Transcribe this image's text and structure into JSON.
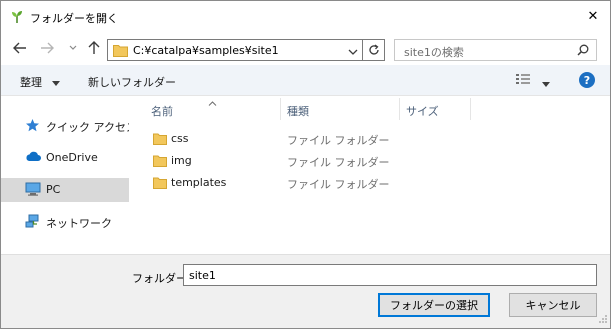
{
  "window": {
    "title": "フォルダーを開く",
    "close_glyph": "✕"
  },
  "address": {
    "path": "C:¥catalpa¥samples¥site1"
  },
  "search": {
    "placeholder": "site1の検索"
  },
  "toolbar": {
    "organize_label": "整理",
    "new_folder_label": "新しいフォルダー",
    "help_label": "?"
  },
  "sidebar": {
    "items": [
      {
        "label": "クイック アクセス",
        "icon": "star-pin-icon",
        "selected": false
      },
      {
        "label": "OneDrive",
        "icon": "cloud-icon",
        "selected": false
      },
      {
        "label": "PC",
        "icon": "computer-icon",
        "selected": true
      },
      {
        "label": "ネットワーク",
        "icon": "network-icon",
        "selected": false
      }
    ]
  },
  "columns": {
    "name": "名前",
    "type": "種類",
    "size": "サイズ"
  },
  "files": [
    {
      "name": "css",
      "type": "ファイル フォルダー"
    },
    {
      "name": "img",
      "type": "ファイル フォルダー"
    },
    {
      "name": "templates",
      "type": "ファイル フォルダー"
    }
  ],
  "footer": {
    "folder_label": "フォルダー:",
    "folder_value": "site1",
    "select_button": "フォルダーの選択",
    "cancel_button": "キャンセル"
  },
  "colors": {
    "accent": "#0078d7",
    "folder": "#f2c75c",
    "toolbar_bg": "#f0f4f9",
    "selected_bg": "#d9d9d9"
  }
}
